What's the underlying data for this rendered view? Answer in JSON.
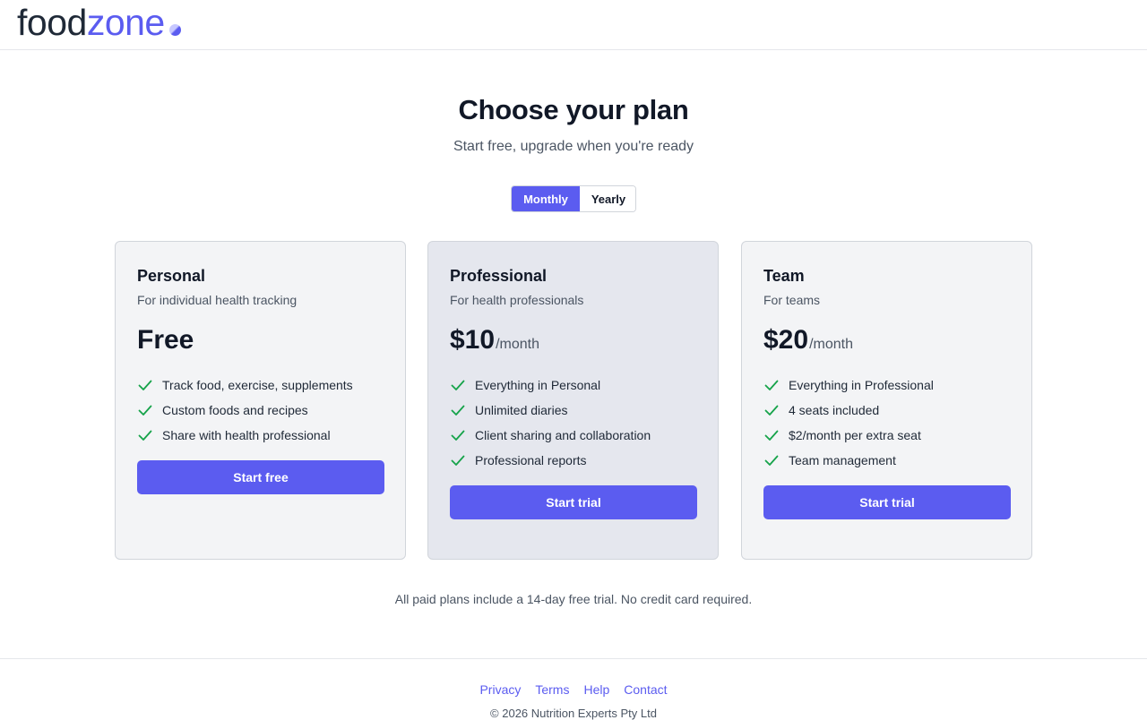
{
  "brand": {
    "logo_part1": "food",
    "logo_part2": "zone",
    "accent_color": "#5b5cf0"
  },
  "hero": {
    "title": "Choose your plan",
    "subtitle": "Start free, upgrade when you're ready"
  },
  "billing_toggle": {
    "selected": "Monthly",
    "options": [
      "Monthly",
      "Yearly"
    ]
  },
  "plans": [
    {
      "name": "Personal",
      "description": "For individual health tracking",
      "price": "Free",
      "period": "",
      "features": [
        "Track food, exercise, supplements",
        "Custom foods and recipes",
        "Share with health professional"
      ],
      "cta": "Start free",
      "highlighted": false
    },
    {
      "name": "Professional",
      "description": "For health professionals",
      "price": "$10",
      "period": "/month",
      "features": [
        "Everything in Personal",
        "Unlimited diaries",
        "Client sharing and collaboration",
        "Professional reports"
      ],
      "cta": "Start trial",
      "highlighted": true
    },
    {
      "name": "Team",
      "description": "For teams",
      "price": "$20",
      "period": "/month",
      "features": [
        "Everything in Professional",
        "4 seats included",
        "$2/month per extra seat",
        "Team management"
      ],
      "cta": "Start trial",
      "highlighted": false
    }
  ],
  "check_icon": {
    "name": "check-icon",
    "color": "#16a34a"
  },
  "note": "All paid plans include a 14-day free trial. No credit card required.",
  "footer": {
    "links": [
      "Privacy",
      "Terms",
      "Help",
      "Contact"
    ],
    "copyright": "© 2026 Nutrition Experts Pty Ltd"
  }
}
